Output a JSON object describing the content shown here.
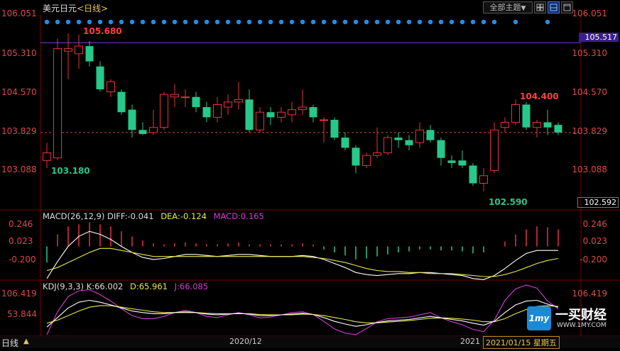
{
  "header": {
    "symbol": "美元日元",
    "period": "<日线>",
    "theme_button": "全部主题",
    "theme_arrow": "▼"
  },
  "colors": {
    "up": "#e8333a",
    "down": "#26c98a",
    "axis": "#d94a4a",
    "grid": "#7a0000",
    "diff": "#ffffff",
    "dea": "#e8e84a",
    "kdj_j": "#d43cd4",
    "signal_dots": "#1f8fe8",
    "ref_line": "#7b3fd8"
  },
  "chart_data": [
    {
      "type": "candlestick",
      "title": "美元日元 <日线>",
      "ylim": [
        102.59,
        106.051
      ],
      "y_ticks": [
        "106.051",
        "105.310",
        "104.570",
        "103.829",
        "103.088"
      ],
      "ref_line_value": "105.517",
      "current_price": "102.592",
      "annotations": {
        "max": "105.680",
        "min_left": "103.180",
        "max_right": "104.400",
        "min": "102.590"
      },
      "candles": [
        {
          "o": 103.2,
          "h": 103.55,
          "l": 103.05,
          "c": 103.35
        },
        {
          "o": 103.25,
          "h": 105.6,
          "l": 103.2,
          "c": 105.4
        },
        {
          "o": 105.35,
          "h": 105.7,
          "l": 104.8,
          "c": 105.4
        },
        {
          "o": 105.3,
          "h": 105.68,
          "l": 105.0,
          "c": 105.45
        },
        {
          "o": 105.45,
          "h": 105.55,
          "l": 105.05,
          "c": 105.15
        },
        {
          "o": 105.05,
          "h": 105.15,
          "l": 104.55,
          "c": 104.6
        },
        {
          "o": 104.55,
          "h": 104.8,
          "l": 104.45,
          "c": 104.75
        },
        {
          "o": 104.55,
          "h": 104.6,
          "l": 104.1,
          "c": 104.15
        },
        {
          "o": 104.2,
          "h": 104.3,
          "l": 103.65,
          "c": 103.8
        },
        {
          "o": 103.8,
          "h": 103.95,
          "l": 103.7,
          "c": 103.72
        },
        {
          "o": 103.75,
          "h": 104.2,
          "l": 103.7,
          "c": 103.85
        },
        {
          "o": 103.85,
          "h": 104.55,
          "l": 103.8,
          "c": 104.5
        },
        {
          "o": 104.45,
          "h": 104.7,
          "l": 104.25,
          "c": 104.5
        },
        {
          "o": 104.45,
          "h": 104.6,
          "l": 104.25,
          "c": 104.45
        },
        {
          "o": 104.45,
          "h": 104.55,
          "l": 104.15,
          "c": 104.25
        },
        {
          "o": 104.25,
          "h": 104.35,
          "l": 103.95,
          "c": 104.05
        },
        {
          "o": 104.05,
          "h": 104.45,
          "l": 103.95,
          "c": 104.3
        },
        {
          "o": 104.25,
          "h": 104.5,
          "l": 104.1,
          "c": 104.35
        },
        {
          "o": 104.35,
          "h": 104.75,
          "l": 104.2,
          "c": 104.4
        },
        {
          "o": 104.4,
          "h": 104.6,
          "l": 103.75,
          "c": 103.8
        },
        {
          "o": 103.8,
          "h": 104.25,
          "l": 103.75,
          "c": 104.15
        },
        {
          "o": 104.15,
          "h": 104.25,
          "l": 103.9,
          "c": 104.05
        },
        {
          "o": 104.05,
          "h": 104.25,
          "l": 103.95,
          "c": 104.15
        },
        {
          "o": 104.1,
          "h": 104.35,
          "l": 103.95,
          "c": 104.2
        },
        {
          "o": 104.2,
          "h": 104.6,
          "l": 104.1,
          "c": 104.25
        },
        {
          "o": 104.25,
          "h": 104.3,
          "l": 103.95,
          "c": 104.05
        },
        {
          "o": 104.0,
          "h": 104.05,
          "l": 103.55,
          "c": 104.0
        },
        {
          "o": 104.0,
          "h": 104.05,
          "l": 103.6,
          "c": 103.65
        },
        {
          "o": 103.65,
          "h": 103.75,
          "l": 103.4,
          "c": 103.45
        },
        {
          "o": 103.45,
          "h": 103.5,
          "l": 102.95,
          "c": 103.1
        },
        {
          "o": 103.1,
          "h": 103.35,
          "l": 103.05,
          "c": 103.3
        },
        {
          "o": 103.3,
          "h": 103.85,
          "l": 103.25,
          "c": 103.35
        },
        {
          "o": 103.35,
          "h": 103.7,
          "l": 103.3,
          "c": 103.65
        },
        {
          "o": 103.65,
          "h": 103.75,
          "l": 103.45,
          "c": 103.6
        },
        {
          "o": 103.6,
          "h": 103.7,
          "l": 103.4,
          "c": 103.5
        },
        {
          "o": 103.55,
          "h": 103.95,
          "l": 103.45,
          "c": 103.8
        },
        {
          "o": 103.8,
          "h": 103.9,
          "l": 103.55,
          "c": 103.6
        },
        {
          "o": 103.6,
          "h": 103.65,
          "l": 103.1,
          "c": 103.25
        },
        {
          "o": 103.2,
          "h": 103.3,
          "l": 103.05,
          "c": 103.15
        },
        {
          "o": 103.2,
          "h": 103.4,
          "l": 103.05,
          "c": 103.1
        },
        {
          "o": 103.1,
          "h": 103.15,
          "l": 102.7,
          "c": 102.75
        },
        {
          "o": 102.75,
          "h": 103.05,
          "l": 102.59,
          "c": 102.9
        },
        {
          "o": 103.0,
          "h": 103.95,
          "l": 102.95,
          "c": 103.8
        },
        {
          "o": 103.85,
          "h": 104.05,
          "l": 103.75,
          "c": 103.95
        },
        {
          "o": 103.95,
          "h": 104.4,
          "l": 103.9,
          "c": 104.3
        },
        {
          "o": 104.3,
          "h": 104.35,
          "l": 103.8,
          "c": 103.85
        },
        {
          "o": 103.85,
          "h": 104.0,
          "l": 103.65,
          "c": 103.95
        },
        {
          "o": 103.95,
          "h": 104.2,
          "l": 103.7,
          "c": 103.85
        },
        {
          "o": 103.9,
          "h": 103.95,
          "l": 103.7,
          "c": 103.75
        }
      ]
    },
    {
      "type": "bar",
      "title": "MACD(26,12,9)",
      "diff_label": "DIFF:-0.041",
      "dea_label": "DEA:-0.124",
      "macd_label": "MACD:0.165",
      "y_ticks": [
        "0.246",
        "0.023",
        "-0.200"
      ],
      "ylim": [
        -0.3,
        0.3
      ],
      "macd_bars": [
        -0.16,
        0.12,
        0.2,
        0.22,
        0.24,
        0.22,
        0.2,
        0.15,
        0.1,
        0.06,
        0.03,
        0.02,
        0.03,
        0.04,
        0.03,
        0.02,
        0.02,
        0.03,
        0.04,
        0.02,
        0.02,
        0.02,
        0.02,
        0.02,
        0.03,
        0.02,
        -0.03,
        -0.06,
        -0.09,
        -0.13,
        -0.12,
        -0.1,
        -0.08,
        -0.06,
        -0.05,
        -0.03,
        -0.03,
        -0.04,
        -0.04,
        -0.05,
        -0.07,
        -0.06,
        0.0,
        0.05,
        0.12,
        0.17,
        0.2,
        0.19,
        0.17
      ],
      "diff": [
        -0.32,
        -0.15,
        0.0,
        0.1,
        0.15,
        0.12,
        0.07,
        0.0,
        -0.06,
        -0.11,
        -0.13,
        -0.12,
        -0.1,
        -0.08,
        -0.08,
        -0.09,
        -0.1,
        -0.09,
        -0.08,
        -0.08,
        -0.09,
        -0.1,
        -0.1,
        -0.1,
        -0.09,
        -0.1,
        -0.13,
        -0.17,
        -0.21,
        -0.26,
        -0.28,
        -0.29,
        -0.28,
        -0.27,
        -0.27,
        -0.26,
        -0.26,
        -0.27,
        -0.28,
        -0.29,
        -0.32,
        -0.33,
        -0.29,
        -0.22,
        -0.14,
        -0.07,
        -0.04,
        -0.04,
        -0.04
      ],
      "dea": [
        -0.24,
        -0.21,
        -0.16,
        -0.11,
        -0.06,
        -0.02,
        -0.02,
        -0.04,
        -0.06,
        -0.08,
        -0.1,
        -0.1,
        -0.1,
        -0.1,
        -0.1,
        -0.1,
        -0.1,
        -0.1,
        -0.1,
        -0.1,
        -0.1,
        -0.1,
        -0.1,
        -0.1,
        -0.1,
        -0.11,
        -0.12,
        -0.14,
        -0.16,
        -0.19,
        -0.22,
        -0.24,
        -0.25,
        -0.25,
        -0.26,
        -0.26,
        -0.27,
        -0.27,
        -0.27,
        -0.28,
        -0.29,
        -0.3,
        -0.3,
        -0.28,
        -0.25,
        -0.21,
        -0.17,
        -0.14,
        -0.12
      ]
    },
    {
      "type": "line",
      "title": "KDJ(9,3,3)",
      "k_label": "K:66.002",
      "d_label": "D:65.961",
      "j_label": "J:66.085",
      "y_ticks": [
        "106.419",
        "53.844"
      ],
      "ylim": [
        0,
        130
      ],
      "k": [
        20,
        45,
        70,
        85,
        90,
        85,
        78,
        70,
        62,
        58,
        55,
        55,
        58,
        60,
        58,
        54,
        52,
        54,
        56,
        54,
        50,
        50,
        52,
        54,
        56,
        53,
        45,
        35,
        28,
        22,
        26,
        32,
        36,
        38,
        40,
        44,
        48,
        44,
        40,
        36,
        30,
        25,
        35,
        58,
        78,
        88,
        90,
        80,
        72
      ],
      "d": [
        30,
        38,
        50,
        62,
        72,
        76,
        76,
        72,
        68,
        64,
        60,
        58,
        58,
        58,
        58,
        56,
        55,
        55,
        55,
        55,
        53,
        52,
        52,
        52,
        54,
        53,
        50,
        45,
        40,
        34,
        31,
        31,
        33,
        35,
        37,
        40,
        43,
        44,
        43,
        41,
        38,
        34,
        34,
        42,
        55,
        66,
        74,
        76,
        74
      ],
      "j": [
        0,
        60,
        100,
        115,
        118,
        105,
        88,
        68,
        50,
        42,
        42,
        48,
        58,
        64,
        58,
        48,
        45,
        52,
        58,
        52,
        44,
        46,
        52,
        58,
        60,
        53,
        35,
        15,
        4,
        0,
        16,
        34,
        42,
        44,
        46,
        52,
        58,
        44,
        34,
        26,
        14,
        8,
        38,
        90,
        120,
        130,
        122,
        88,
        68
      ]
    }
  ],
  "xaxis": {
    "tick_left": "2020/12",
    "tick_right_year": "2021",
    "tick_right_date": "2021/01/15",
    "weekday": "星期五"
  },
  "footer": {
    "period_button": "日线",
    "arrow": "▲"
  },
  "watermark": {
    "name": "一买财经",
    "url": "WWW.1MY.COM",
    "logo_text": "1my"
  }
}
